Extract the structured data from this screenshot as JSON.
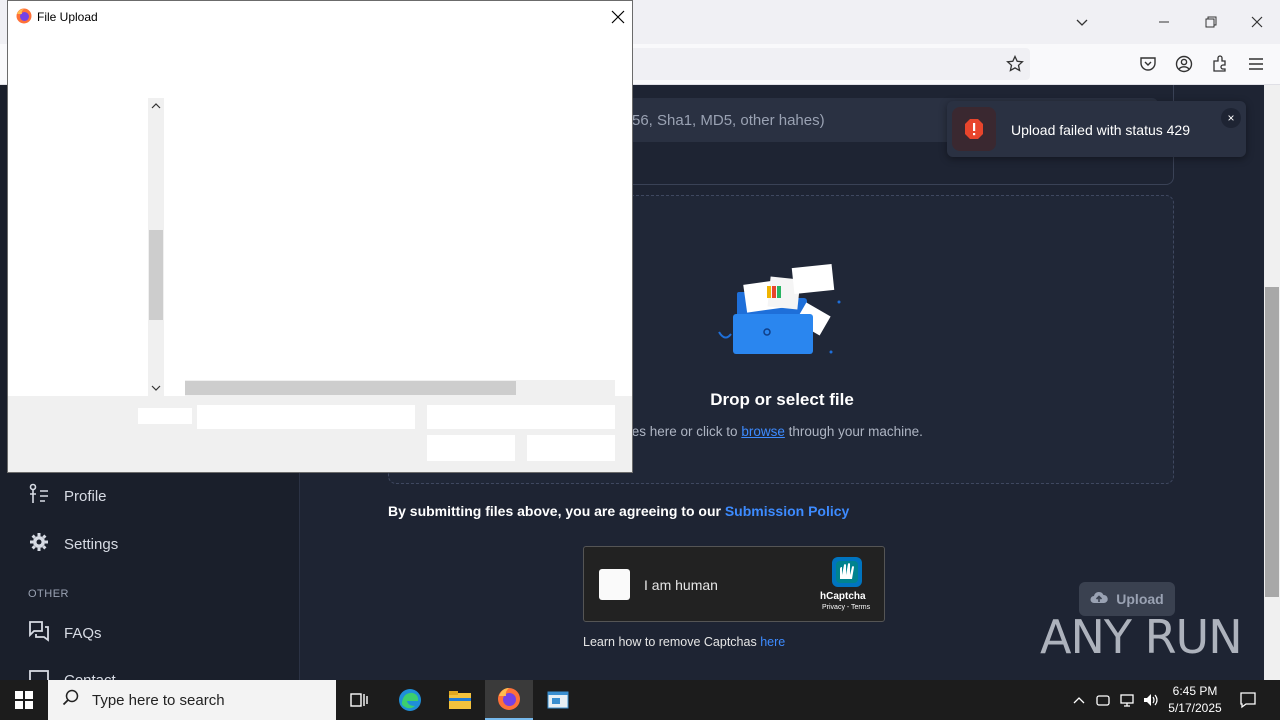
{
  "browser": {
    "window_controls": [
      "list-all-tabs",
      "minimize",
      "restore",
      "close"
    ]
  },
  "sidebar": {
    "items": [
      {
        "label": "Profile",
        "icon": "profile-icon"
      },
      {
        "label": "Settings",
        "icon": "gear-icon"
      }
    ],
    "section_other": "OTHER",
    "other_items": [
      {
        "label": "FAQs",
        "icon": "faq-icon"
      },
      {
        "label": "Contact",
        "icon": "contact-icon"
      }
    ]
  },
  "main": {
    "hash_placeholder_visible": "56, Sha1, MD5, other hahes)",
    "drop_title": "Drop or select file",
    "drop_sub_prefix": "files here or click to",
    "drop_sub_link": "browse",
    "drop_sub_suffix": "through your machine.",
    "policy_text": "By submitting files above, you are agreeing to our",
    "policy_link": "Submission Policy",
    "captcha_label": "I am human",
    "captcha_brand": "hCaptcha",
    "captcha_links": "Privacy - Terms",
    "learn_text": "Learn how to remove Captchas",
    "learn_link": "here",
    "upload_button": "Upload",
    "watermark": "ANY RUN"
  },
  "toast": {
    "message": "Upload failed with status 429",
    "close": "×",
    "color": "#e8452c"
  },
  "dialog": {
    "title": "File Upload"
  },
  "taskbar": {
    "search_placeholder": "Type here to search",
    "time": "6:45 PM",
    "date": "5/17/2025"
  }
}
